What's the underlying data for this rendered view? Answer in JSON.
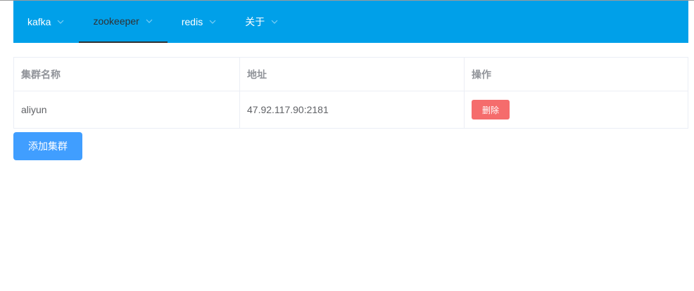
{
  "colors": {
    "navbar_bg": "#00a0e9",
    "delete_button": "#f56c6c",
    "primary_button": "#409eff"
  },
  "nav": {
    "items": [
      {
        "label": "kafka",
        "icon": "chevron-down-icon",
        "active": false
      },
      {
        "label": "zookeeper",
        "icon": "chevron-down-icon",
        "active": true
      },
      {
        "label": "redis",
        "icon": "chevron-down-icon",
        "active": false
      },
      {
        "label": "关于",
        "icon": "chevron-down-icon",
        "active": false
      }
    ]
  },
  "table": {
    "headers": [
      "集群名称",
      "地址",
      "操作"
    ],
    "rows": [
      {
        "name": "aliyun",
        "address": "47.92.117.90:2181",
        "action_label": "删除"
      }
    ]
  },
  "actions": {
    "add_cluster_label": "添加集群"
  }
}
